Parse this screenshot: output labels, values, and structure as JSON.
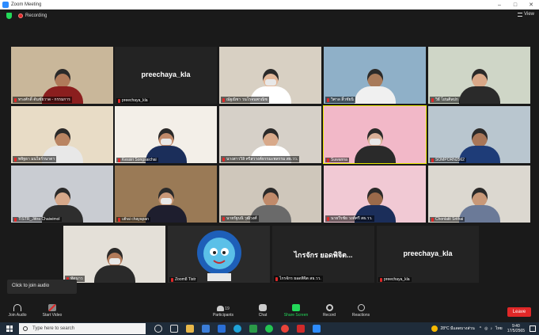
{
  "window": {
    "title": "Zoom Meeting",
    "minimize": "–",
    "maximize": "□",
    "close": "✕"
  },
  "topbar": {
    "recording": "Recording",
    "view": "View"
  },
  "tiles": [
    {
      "name": "ทรงศักดิ์ ต้นชัยวาด - กรรมการ",
      "kind": "video",
      "bg": "#c9b79a",
      "skin": "#b07a5a",
      "shirt": "#8b1e1e"
    },
    {
      "name": "preechaya_kla",
      "kind": "name",
      "label": "preechaya_kla"
    },
    {
      "name": "ณัฐณิชา วนโรจนพาณิช",
      "kind": "video",
      "bg": "#d8d0c3",
      "skin": "#e2b89a",
      "shirt": "#ffffff",
      "mask": true
    },
    {
      "name": "วิศาล สิ้วชัยนิ",
      "kind": "video",
      "bg": "#8fb0c8",
      "skin": "#a87a5a",
      "shirt": "#f0f0f0"
    },
    {
      "name": "วิธี โย่นศิลปก",
      "kind": "video",
      "bg": "#cfd6c7",
      "skin": "#d9a888",
      "shirt": "#2a2a2a"
    },
    {
      "name": "พจิฐธา มนไธร์รนาดา",
      "kind": "video",
      "bg": "#e8dcc6",
      "skin": "#b98462",
      "shirt": "#e8e8e8"
    },
    {
      "name": "Kessiri Songsaichai",
      "kind": "video",
      "bg": "#f3efe8",
      "skin": "#c08a6a",
      "shirt": "#1b2e5a",
      "mask": true
    },
    {
      "name": "นางสาววิลิ ศรีสวางค์ธรรมะพลรรม สธ.วว.",
      "kind": "video",
      "bg": "#d6d0c8",
      "skin": "#d8a98a",
      "shirt": "#ffffff"
    },
    {
      "name": "Suwanna",
      "kind": "video",
      "bg": "#f2b8c8",
      "skin": "#d8b098",
      "shirt": "#2a2a2a",
      "mask": true
    },
    {
      "name": "SOMPORN2562",
      "kind": "video",
      "bg": "#b9c6cf",
      "skin": "#a87658",
      "shirt": "#1e3c78"
    },
    {
      "name": "TISTR_Jittra Chaiwimol",
      "kind": "video",
      "bg": "#c9ccd2",
      "skin": "#d6a88a",
      "shirt": "#2e2e2e"
    },
    {
      "name": "uthai chayapan",
      "kind": "video",
      "bg": "#9a7a56",
      "skin": "#c99878",
      "shirt": "#1e1e2e",
      "mask": true
    },
    {
      "name": "นายรัฐนนิ วุฒิวงศ์",
      "kind": "video",
      "bg": "#cfc7bb",
      "skin": "#c08a6a",
      "shirt": "#6a6a6a"
    },
    {
      "name": "นายวีรชัย วงศ์ศรี สธ.วว.",
      "kind": "video",
      "bg": "#f1c9d4",
      "skin": "#9a6a4a",
      "shirt": "#1b2e5a"
    },
    {
      "name": "Chonlatit Srithai",
      "kind": "video",
      "bg": "#dcd8d0",
      "skin": "#c89878",
      "shirt": "#6b7a98"
    },
    {
      "name": "ทัดนาว",
      "kind": "video",
      "bg": "#e4e0d8",
      "skin": "#b07a5a",
      "shirt": "#2a2a2a",
      "mask": true
    },
    {
      "name": "Zoom8 Tistr",
      "kind": "avatar"
    },
    {
      "name": "ไกรจักร ยอดพิจิต สธ.วว.",
      "kind": "name",
      "label": "ไกรจักร ยอดพิจิต..."
    },
    {
      "name": "preechaya_kla",
      "kind": "name",
      "label": "preechaya_kla"
    }
  ],
  "overlay": {
    "click_to_join_audio": "Click to join audio"
  },
  "toolbar": {
    "join_audio": "Join Audio",
    "start_video": "Start Video",
    "participants": "Participants",
    "participants_count": "19",
    "chat": "Chat",
    "share_screen": "Share Screen",
    "record": "Record",
    "reactions": "Reactions",
    "leave": "Leave"
  },
  "taskbar": {
    "search_placeholder": "Type here to search",
    "weather": "28°C มีแดดบางส่วน",
    "lang": "ไทย",
    "time": "9:40",
    "date": "17/5/2565"
  },
  "colors": {
    "accent_green": "#23d959",
    "leave_red": "#e02828",
    "share_green": "#23d959",
    "zoom_blue": "#2d8cff"
  }
}
